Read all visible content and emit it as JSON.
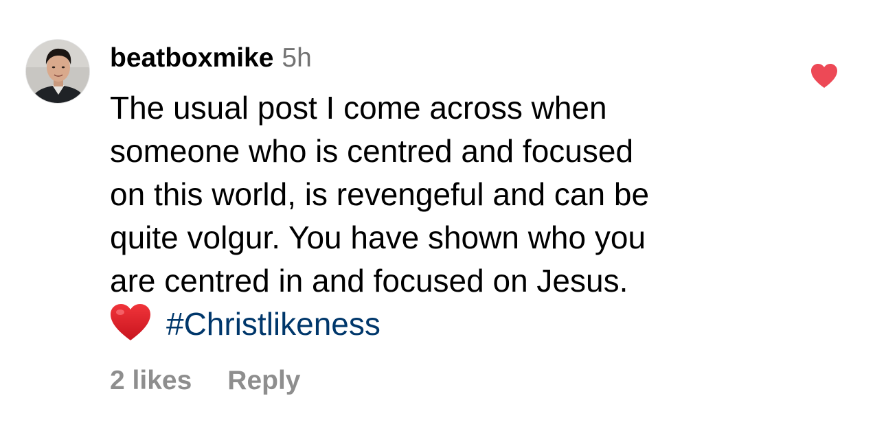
{
  "comment": {
    "username": "beatboxmike",
    "time": "5h",
    "body_lines": [
      "The usual post I come across when",
      "someone who is centred and focused",
      "on this world, is revengeful and can be",
      "quite volgur. You have shown who you",
      "are centred in and focused on Jesus."
    ],
    "emoji": "❤️",
    "hashtag": "#Christlikeness",
    "likes_label": "2 likes",
    "reply_label": "Reply",
    "liked": true
  },
  "colors": {
    "text": "#000000",
    "secondary": "#737373",
    "action": "#8e8e8e",
    "hashtag": "#00376b",
    "like_heart": "#ed4956"
  },
  "icons": {
    "avatar": "profile-photo",
    "like": "heart-filled-icon",
    "emoji": "red-heart-emoji"
  }
}
